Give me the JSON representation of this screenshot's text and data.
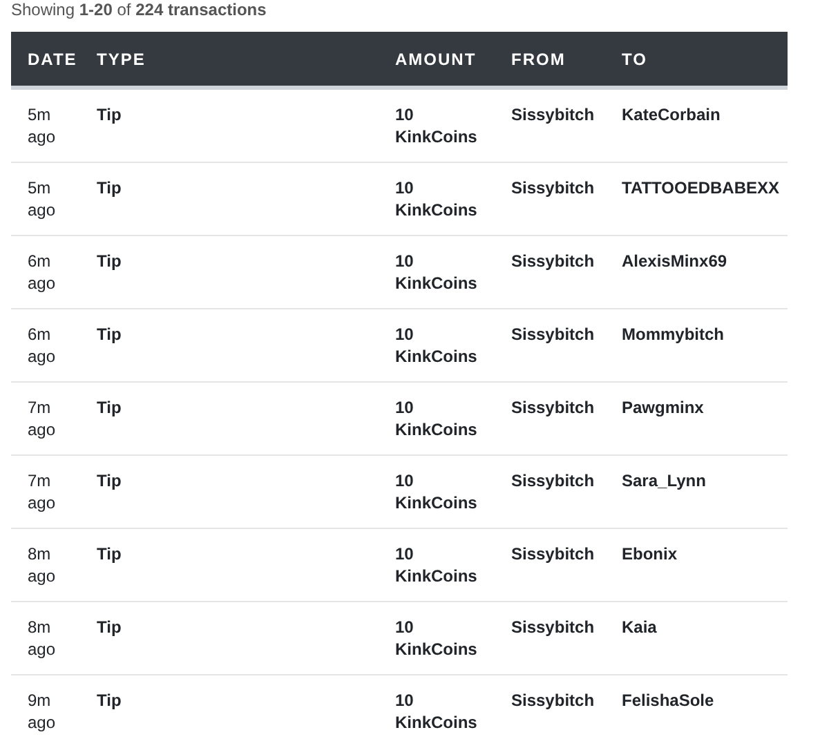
{
  "summary": "Showing **1-20** of **224 transactions**",
  "table": {
    "columns": [
      "DATE",
      "TYPE",
      "AMOUNT",
      "FROM",
      "TO"
    ],
    "rows": [
      {
        "date": "5m ago",
        "type": "Tip",
        "amount": "10 KinkCoins",
        "from": "Sissybitch",
        "to": "KateCorbain"
      },
      {
        "date": "5m ago",
        "type": "Tip",
        "amount": "10 KinkCoins",
        "from": "Sissybitch",
        "to": "TATTOOEDBABEXX"
      },
      {
        "date": "6m ago",
        "type": "Tip",
        "amount": "10 KinkCoins",
        "from": "Sissybitch",
        "to": "AlexisMinx69"
      },
      {
        "date": "6m ago",
        "type": "Tip",
        "amount": "10 KinkCoins",
        "from": "Sissybitch",
        "to": "Mommybitch"
      },
      {
        "date": "7m ago",
        "type": "Tip",
        "amount": "10 KinkCoins",
        "from": "Sissybitch",
        "to": "Pawgminx"
      },
      {
        "date": "7m ago",
        "type": "Tip",
        "amount": "10 KinkCoins",
        "from": "Sissybitch",
        "to": "Sara_Lynn"
      },
      {
        "date": "8m ago",
        "type": "Tip",
        "amount": "10 KinkCoins",
        "from": "Sissybitch",
        "to": "Ebonix"
      },
      {
        "date": "8m ago",
        "type": "Tip",
        "amount": "10 KinkCoins",
        "from": "Sissybitch",
        "to": "Kaia"
      },
      {
        "date": "9m ago",
        "type": "Tip",
        "amount": "10 KinkCoins",
        "from": "Sissybitch",
        "to": "FelishaSole"
      }
    ]
  }
}
